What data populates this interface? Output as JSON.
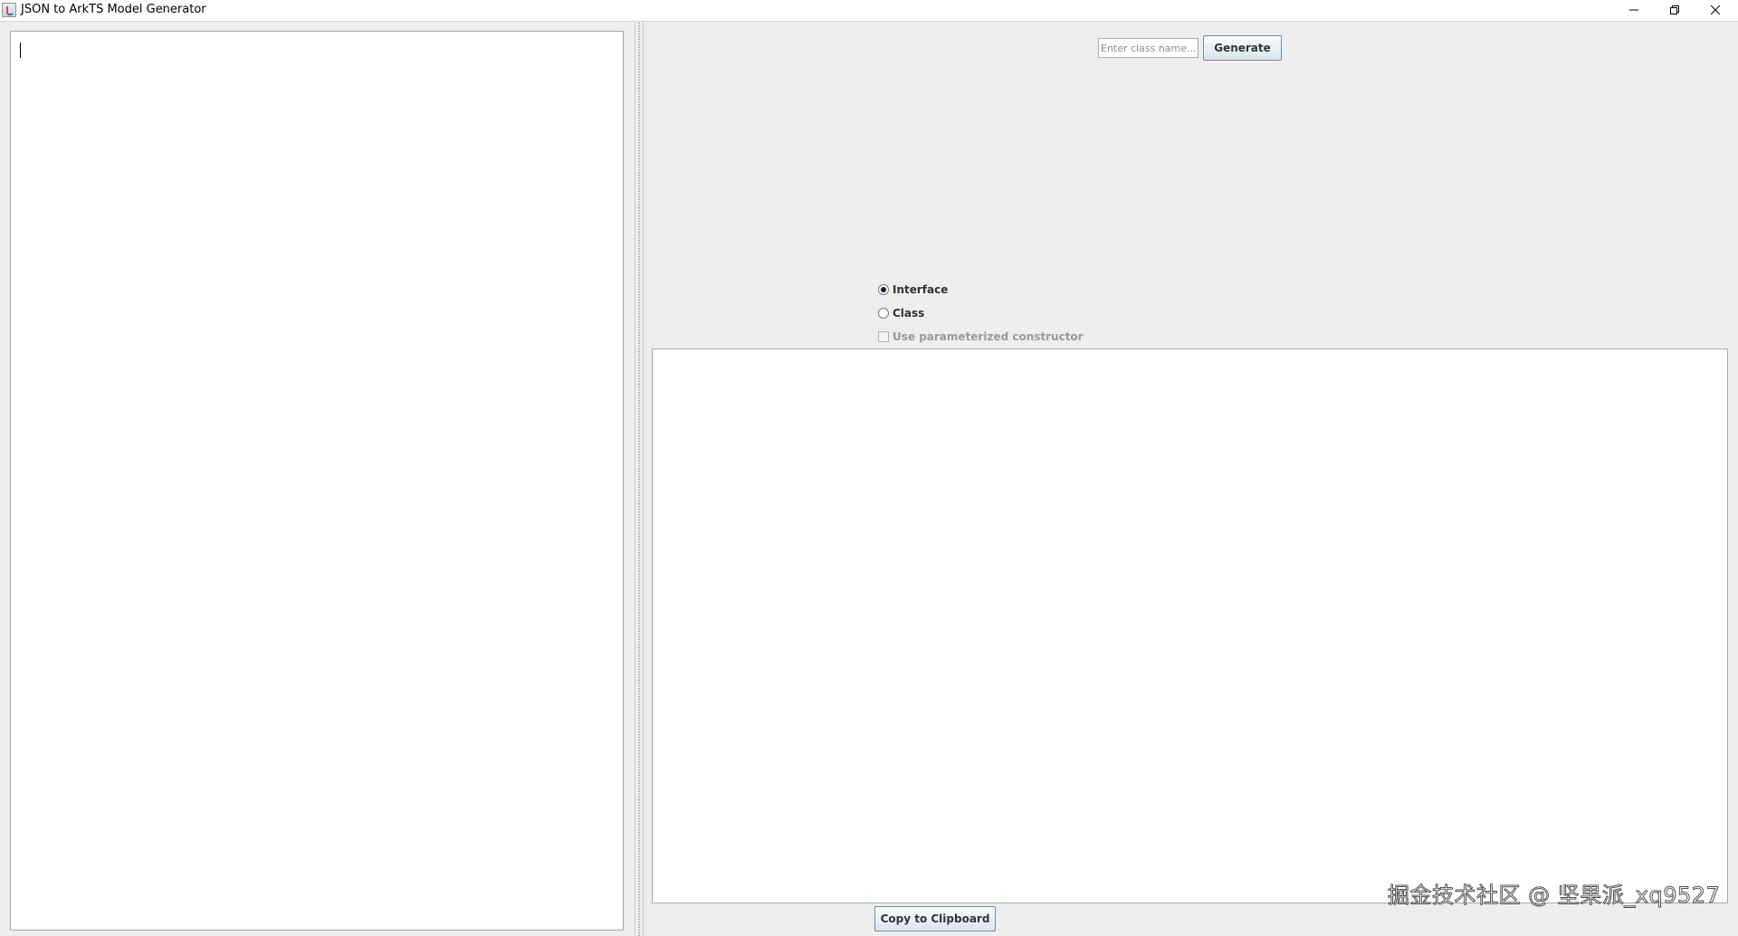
{
  "window": {
    "title": "JSON to ArkTS Model Generator",
    "controls": {
      "minimize": "minimize-icon",
      "restore": "restore-icon",
      "close": "close-icon"
    }
  },
  "left_panel": {
    "json_input_value": ""
  },
  "right_panel": {
    "class_name": {
      "placeholder": "Enter class name...",
      "value": ""
    },
    "generate_label": "Generate",
    "options": {
      "interface_label": "Interface",
      "interface_selected": true,
      "class_label": "Class",
      "class_selected": false,
      "ctor_label": "Use parameterized constructor",
      "ctor_checked": false,
      "ctor_enabled": false
    },
    "output_value": "",
    "copy_label": "Copy to Clipboard"
  },
  "watermark": "掘金技术社区 @ 坚果派_xq9527",
  "colors": {
    "window_bg": "#eeeeee",
    "field_bg": "#ffffff",
    "field_border": "#a9a9a9",
    "disabled_text": "#9a9a9a"
  }
}
